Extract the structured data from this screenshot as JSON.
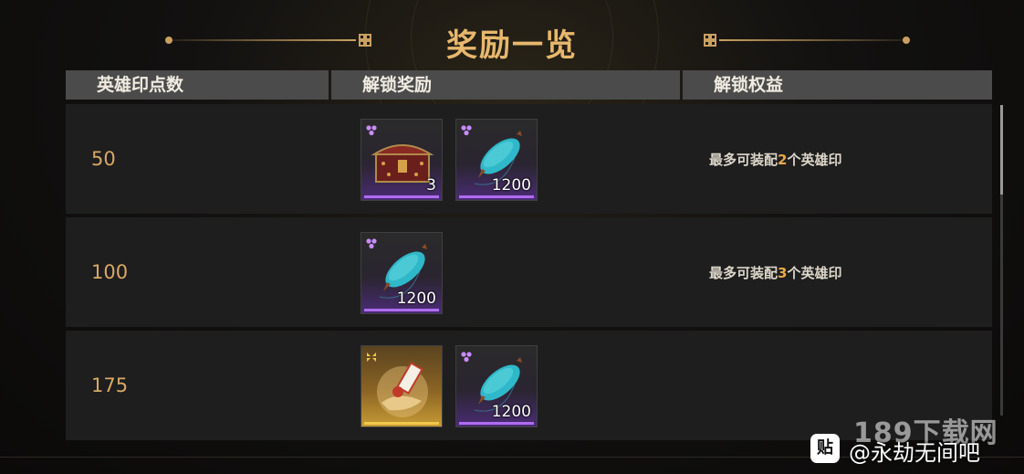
{
  "title": "奖励一览",
  "columns": [
    "英雄印点数",
    "解锁奖励",
    "解锁权益"
  ],
  "rows": [
    {
      "points": "50",
      "items": [
        {
          "icon": "treasure-chest-icon",
          "rarity": "purple",
          "quantity": "3"
        },
        {
          "icon": "cyan-feather-icon",
          "rarity": "purple",
          "quantity": "1200"
        }
      ],
      "benefit": {
        "prefix": "最多可装配",
        "count": "2",
        "suffix": "个英雄印"
      }
    },
    {
      "points": "100",
      "items": [
        {
          "icon": "cyan-feather-icon",
          "rarity": "purple",
          "quantity": "1200"
        }
      ],
      "benefit": {
        "prefix": "最多可装配",
        "count": "3",
        "suffix": "个英雄印"
      }
    },
    {
      "points": "175",
      "items": [
        {
          "icon": "hero-seal-scroll-icon",
          "rarity": "gold",
          "quantity": ""
        },
        {
          "icon": "cyan-feather-icon",
          "rarity": "purple",
          "quantity": "1200"
        }
      ],
      "benefit": null
    }
  ],
  "colors": {
    "accent": "#e7b86d",
    "points": "#d9a865",
    "rarity_purple": "#b06cf0",
    "rarity_gold": "#f2c84a",
    "highlight": "#e7a94c"
  },
  "watermark": {
    "site": "189下载网",
    "logo": "贴",
    "handle": "@永劫无间吧"
  }
}
